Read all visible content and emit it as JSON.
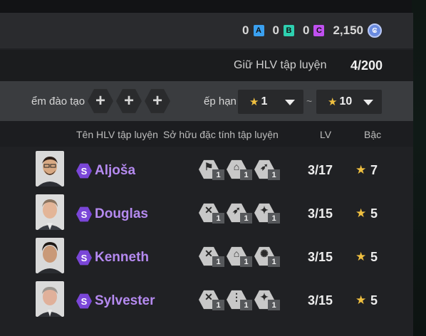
{
  "currencies": [
    {
      "value": "0",
      "letter": "A",
      "color": "#3aa0f0"
    },
    {
      "value": "0",
      "letter": "B",
      "color": "#2ed0b0"
    },
    {
      "value": "0",
      "letter": "C",
      "color": "#c050f0"
    }
  ],
  "points": {
    "value": "2,150",
    "icon": "coin-icon",
    "icon_text": "₢"
  },
  "keep": {
    "label": "Giữ HLV tập luyện",
    "count": "4/200"
  },
  "filters": {
    "train_label": "ểm đào tạo",
    "slot_symbol": "+",
    "rank_label": "ếp hạn",
    "tilde": "~",
    "rank_min": "1",
    "rank_max": "10",
    "star": "★"
  },
  "headers": {
    "name": "Tên HLV tập luyện",
    "traits": "Sở hữu đặc tính tập luyện",
    "lv": "LV",
    "grade": "Bậc"
  },
  "coaches": [
    {
      "badge": "S",
      "name": "Aljoša",
      "lv": "3/17",
      "grade": "7",
      "traits": [
        {
          "icon": "boot-icon",
          "glyph": "⚑",
          "level": "1"
        },
        {
          "icon": "lock-icon",
          "glyph": "⌂",
          "level": "1"
        },
        {
          "icon": "kick-icon",
          "glyph": "➶",
          "level": "1"
        }
      ]
    },
    {
      "badge": "S",
      "name": "Douglas",
      "lv": "3/15",
      "grade": "5",
      "traits": [
        {
          "icon": "dribble-icon",
          "glyph": "✕",
          "level": "1"
        },
        {
          "icon": "kick-icon",
          "glyph": "➶",
          "level": "1"
        },
        {
          "icon": "runner-icon",
          "glyph": "✦",
          "level": "1"
        }
      ]
    },
    {
      "badge": "S",
      "name": "Kenneth",
      "lv": "3/15",
      "grade": "5",
      "traits": [
        {
          "icon": "dribble-icon",
          "glyph": "✕",
          "level": "1"
        },
        {
          "icon": "lock-icon",
          "glyph": "⌂",
          "level": "1"
        },
        {
          "icon": "ball-icon",
          "glyph": "✺",
          "level": "1"
        }
      ]
    },
    {
      "badge": "S",
      "name": "Sylvester",
      "lv": "3/15",
      "grade": "5",
      "traits": [
        {
          "icon": "dribble-icon",
          "glyph": "✕",
          "level": "1"
        },
        {
          "icon": "cones-icon",
          "glyph": "⋮",
          "level": "1"
        },
        {
          "icon": "runner-icon",
          "glyph": "✦",
          "level": "1"
        }
      ]
    }
  ]
}
